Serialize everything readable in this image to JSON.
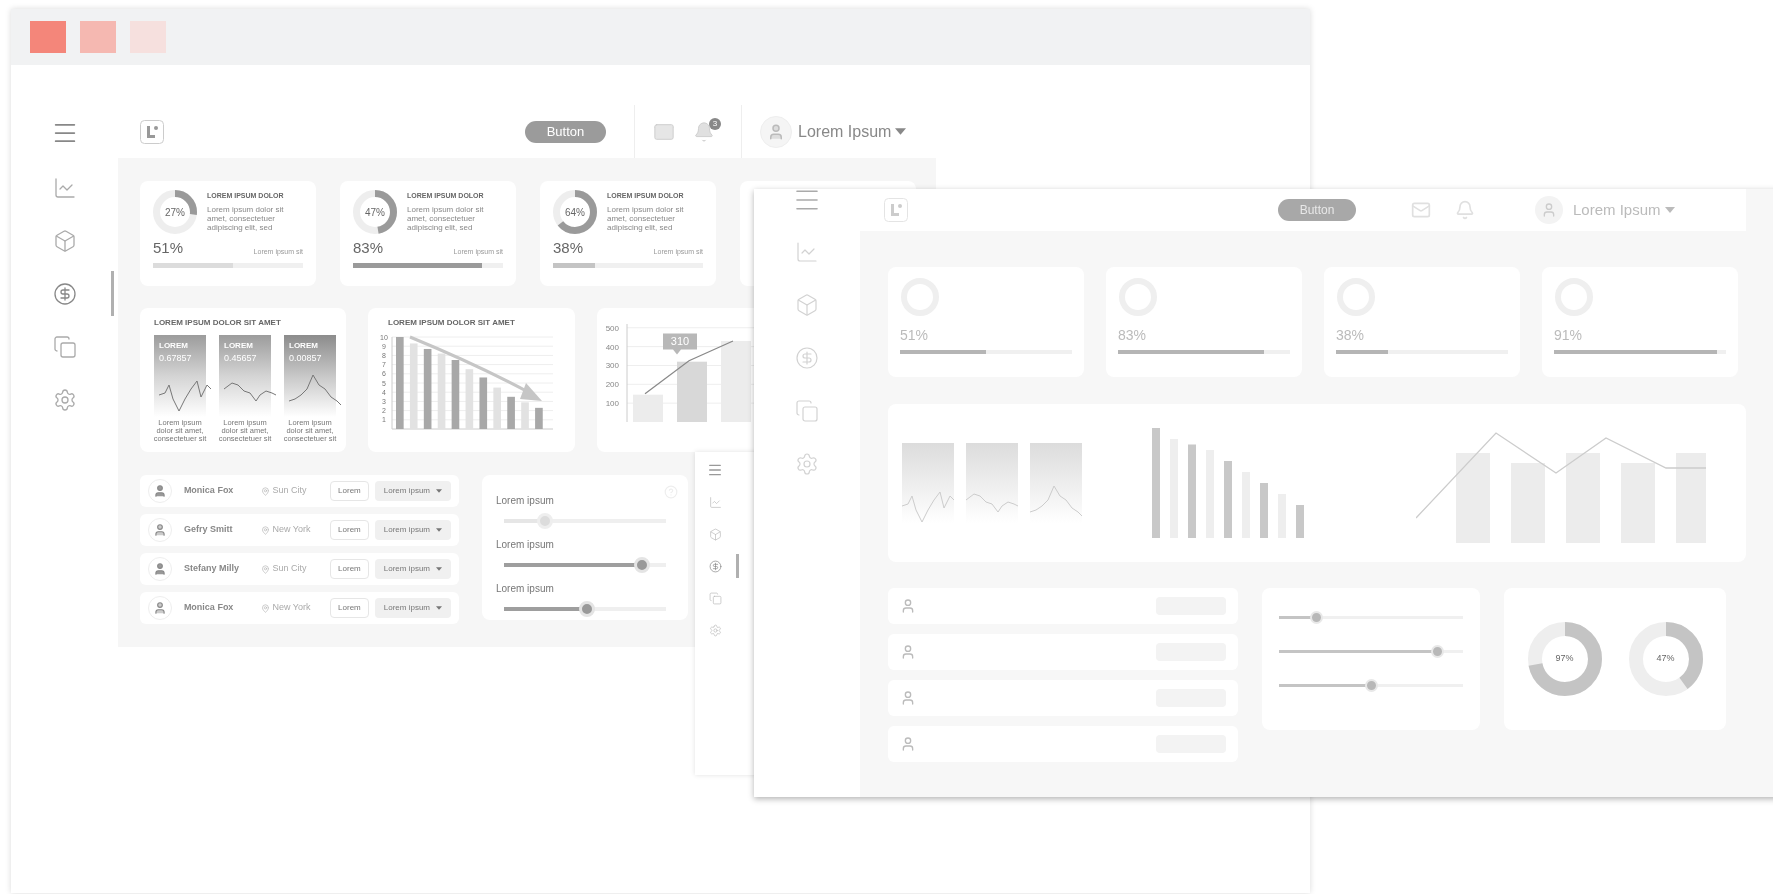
{
  "main_window": {
    "sidebar": {
      "items": [
        {
          "selected": false
        },
        {
          "selected": false
        },
        {
          "selected": true
        },
        {
          "selected": false
        },
        {
          "selected": false
        }
      ]
    },
    "header": {
      "button": "Button",
      "notification_count": "3",
      "user_name": "Lorem Ipsum"
    },
    "stat_cards": [
      {
        "donut": {
          "label": "27%",
          "level": 0.27
        },
        "title": "LOREM IPSUM DOLOR",
        "text": "Lorem ipsum dolor sit amet, consectetuer adipiscing elit, sed",
        "progress": {
          "value": "51%",
          "caption": "Lorem ipsum sit",
          "level": 0.53
        }
      },
      {
        "donut": {
          "label": "47%",
          "level": 0.47
        },
        "title": "LOREM IPSUM DOLOR",
        "text": "Lorem ipsum dolor sit amet, consectetuer adipiscing elit, sed",
        "progress": {
          "value": "83%",
          "caption": "Lorem ipsum sit",
          "level": 0.86
        }
      },
      {
        "donut": {
          "label": "64%",
          "level": 0.64
        },
        "title": "LOREM IPSUM DOLOR",
        "text": "Lorem ipsum dolor sit amet, consectetuer adipiscing elit, sed",
        "progress": {
          "value": "38%",
          "caption": "Lorem ipsum sit",
          "level": 0.28
        }
      }
    ],
    "metrics_card": {
      "title": "LOREM IPSUM DOLOR SIT AMET",
      "tiles": [
        {
          "label": "LOREM",
          "value": "0.67857",
          "caption": "Lorem ipsum dolor sit amet, consectetuer sit"
        },
        {
          "label": "LOREM",
          "value": "0.45657",
          "caption": "Lorem ipsum dolor sit amet, consectetuer sit"
        },
        {
          "label": "LOREM",
          "value": "0.00857",
          "caption": "Lorem ipsum dolor sit amet, consectetuer sit"
        }
      ]
    },
    "bar_chart_card": {
      "title": "LOREM IPSUM DOLOR SIT AMET",
      "chart_data": {
        "type": "bar",
        "values": [
          10,
          9.3,
          8.7,
          8.2,
          7.5,
          6.5,
          5.6,
          4.5,
          3.5,
          2.9,
          2.3
        ],
        "ylim": [
          0,
          10
        ],
        "yticks": [
          1,
          2,
          3,
          4,
          5,
          6,
          7,
          8,
          9,
          10
        ],
        "grid": true
      }
    },
    "line_chart_card": {
      "chart_data": {
        "type": "bar",
        "series": [
          {
            "type": "bar",
            "colors": [
              "#ececec",
              "#d8d8d8",
              "#ececec"
            ],
            "values": [
              145,
              320,
              430
            ]
          },
          {
            "type": "line",
            "values": [
              150,
              325,
              430
            ]
          }
        ],
        "ylim": [
          0,
          520
        ],
        "yticks": [
          100,
          200,
          300,
          400,
          500
        ],
        "grid": true,
        "annotations": [
          "310"
        ]
      }
    },
    "people": [
      {
        "name": "Monica Fox",
        "city": "Sun City",
        "button": "Lorem",
        "dropdown": "Lorem ipsum"
      },
      {
        "name": "Gefry Smitt",
        "city": "New York",
        "button": "Lorem",
        "dropdown": "Lorem ipsum"
      },
      {
        "name": "Stefany Milly",
        "city": "Sun City",
        "button": "Lorem",
        "dropdown": "Lorem ipsum"
      },
      {
        "name": "Monica Fox",
        "city": "New York",
        "button": "Lorem",
        "dropdown": "Lorem ipsum"
      }
    ],
    "sliders": [
      {
        "label": "Lorem ipsum",
        "level": 0.25
      },
      {
        "label": "Lorem ipsum",
        "level": 0.85
      },
      {
        "label": "Lorem ipsum",
        "level": 0.51
      }
    ]
  },
  "side_window": {
    "items": [
      {
        "selected": false
      },
      {
        "selected": false
      },
      {
        "selected": true
      },
      {
        "selected": false
      },
      {
        "selected": false
      }
    ]
  },
  "front_window": {
    "header": {
      "button": "Button",
      "user_name": "Lorem Ipsum"
    },
    "cards": [
      {
        "value": "51%",
        "level": 0.5
      },
      {
        "value": "83%",
        "level": 0.85
      },
      {
        "value": "38%",
        "level": 0.3
      },
      {
        "value": "91%",
        "level": 0.95
      }
    ],
    "sliders": [
      {
        "level": 0.2
      },
      {
        "level": 0.86
      },
      {
        "level": 0.5
      }
    ],
    "donuts": [
      {
        "label": "97%",
        "level": 0.72
      },
      {
        "label": "47%",
        "level": 0.4
      }
    ]
  }
}
